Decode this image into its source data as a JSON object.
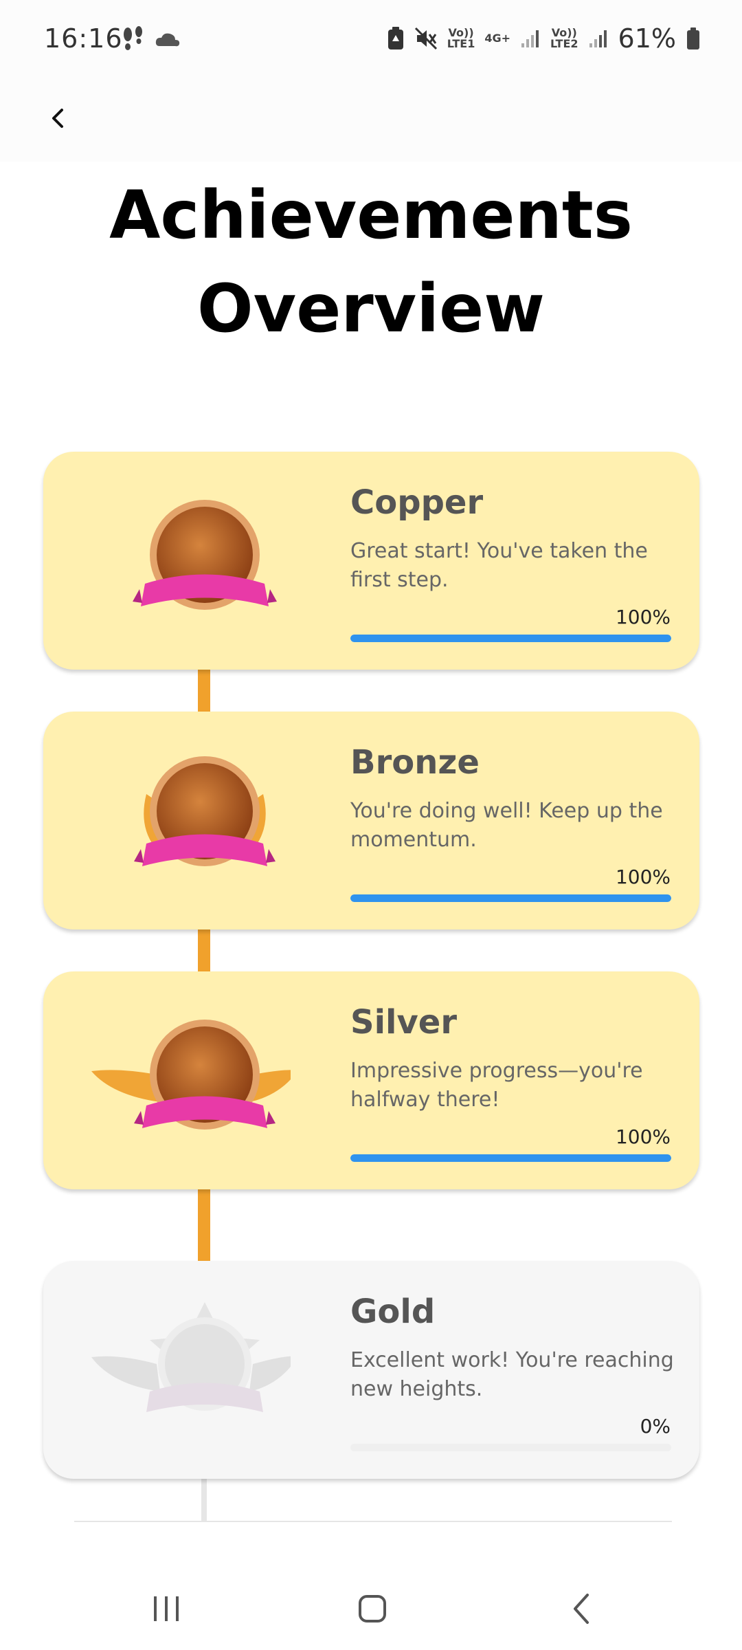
{
  "status_bar": {
    "time": "16:16",
    "battery_percent": "61%",
    "sim1_label_top": "Vo))",
    "sim1_label_bottom": "LTE1",
    "network_label": "4G+",
    "sim2_label_top": "Vo))",
    "sim2_label_bottom": "LTE2",
    "icons": [
      "steps-icon",
      "weather-icon",
      "battery-saver-icon",
      "mute-icon",
      "signal-icon",
      "battery-icon"
    ]
  },
  "app_bar": {
    "back_icon": "chevron-left-icon"
  },
  "page": {
    "title_line1": "Achievements",
    "title_line2": "Overview"
  },
  "achievements": [
    {
      "title": "Copper",
      "description": "Great start! You've taken the first step.",
      "percent_label": "100%",
      "progress": 1.0,
      "unlocked": true,
      "medal": "copper-medal-icon"
    },
    {
      "title": "Bronze",
      "description": "You're doing well! Keep up the momentum.",
      "percent_label": "100%",
      "progress": 1.0,
      "unlocked": true,
      "medal": "bronze-medal-icon"
    },
    {
      "title": "Silver",
      "description": "Impressive progress—you're halfway there!",
      "percent_label": "100%",
      "progress": 1.0,
      "unlocked": true,
      "medal": "silver-medal-icon"
    },
    {
      "title": "Gold",
      "description": "Excellent work! You're reaching new heights.",
      "percent_label": "0%",
      "progress": 0.0,
      "unlocked": false,
      "medal": "gold-medal-icon"
    }
  ],
  "colors": {
    "card_unlocked": "#fff0b0",
    "card_locked": "#f6f6f6",
    "progress": "#2f93ee",
    "connector": "#f0a12c"
  },
  "nav_bar": {
    "icons": [
      "recent-apps-icon",
      "home-icon",
      "back-icon"
    ]
  }
}
